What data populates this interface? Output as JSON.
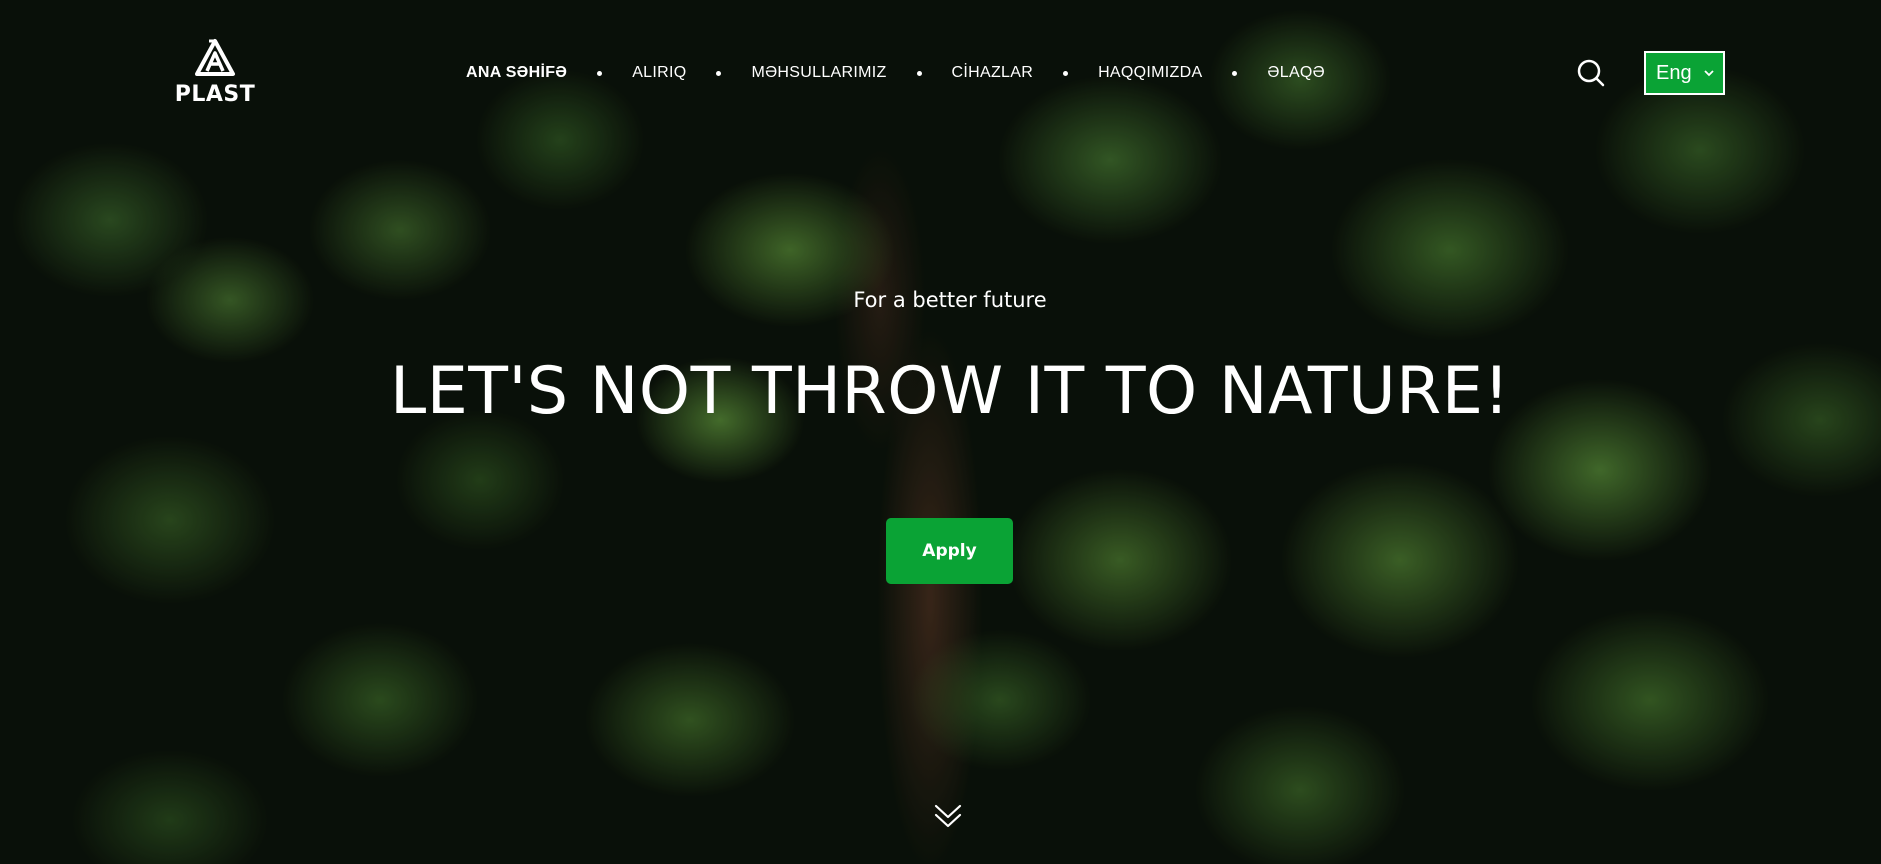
{
  "brand": {
    "name": "PLAST",
    "logo_icon": "recycle-triangle-a-icon"
  },
  "nav": {
    "items": [
      {
        "label": "ANA SƏHİFƏ",
        "active": true
      },
      {
        "label": "ALIRIQ",
        "active": false
      },
      {
        "label": "MƏHSULLARIMIZ",
        "active": false
      },
      {
        "label": "CİHAZLAR",
        "active": false
      },
      {
        "label": "HAQQIMIZDA",
        "active": false
      },
      {
        "label": "ƏLAQƏ",
        "active": false
      }
    ]
  },
  "header": {
    "search_icon": "search-icon",
    "language": {
      "selected": "Eng",
      "icon": "chevron-down-icon"
    }
  },
  "hero": {
    "subtitle": "For a better future",
    "headline": "LET'S NOT THROW IT TO NATURE!",
    "cta_label": "Apply",
    "scroll_icon": "double-chevron-down-icon"
  },
  "colors": {
    "accent": "#0aa335",
    "text": "#ffffff"
  }
}
